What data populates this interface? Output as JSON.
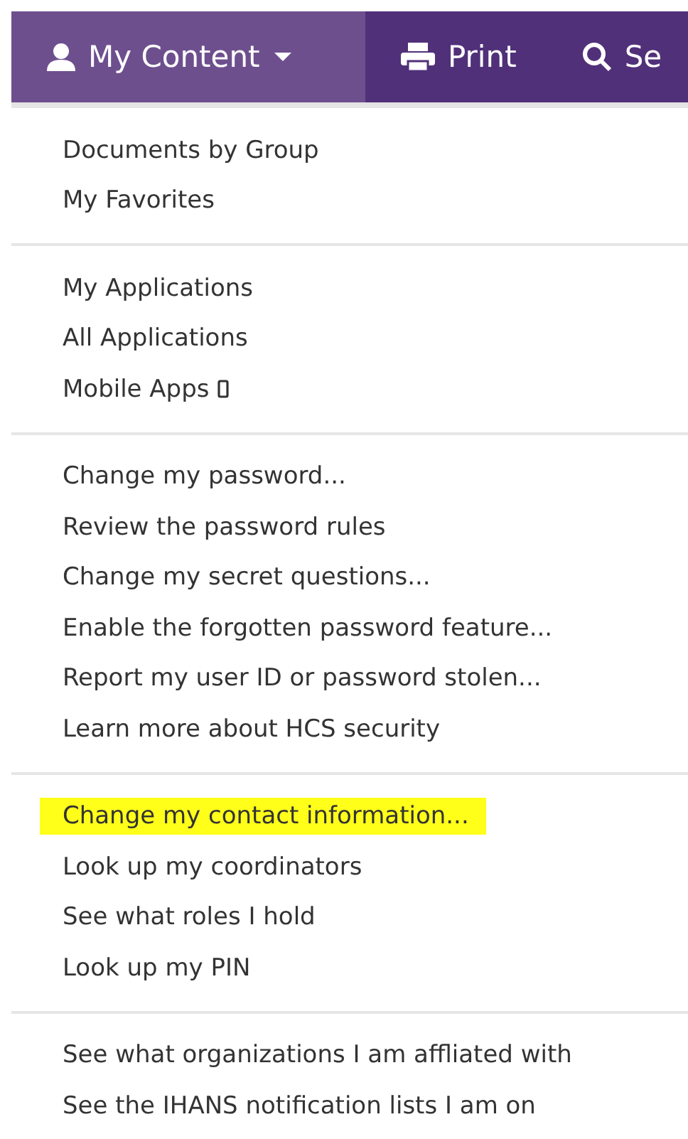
{
  "nav": {
    "tabs": [
      {
        "label": "My Content",
        "kind": "user",
        "caret": true,
        "selected": true
      },
      {
        "label": "Print",
        "kind": "printer",
        "caret": false,
        "selected": false
      },
      {
        "label": "Se",
        "kind": "search",
        "caret": false,
        "selected": false
      }
    ]
  },
  "menu": {
    "groups": [
      {
        "items": [
          {
            "label": "Documents by Group",
            "highlighted": false
          },
          {
            "label": "My Favorites",
            "highlighted": false
          }
        ]
      },
      {
        "items": [
          {
            "label": "My Applications",
            "highlighted": false
          },
          {
            "label": "All Applications",
            "highlighted": false
          },
          {
            "label": "Mobile Apps",
            "kind": "phone",
            "highlighted": false
          }
        ]
      },
      {
        "items": [
          {
            "label": "Change my password...",
            "highlighted": false
          },
          {
            "label": "Review the password rules",
            "highlighted": false
          },
          {
            "label": "Change my secret questions...",
            "highlighted": false
          },
          {
            "label": "Enable the forgotten password feature...",
            "highlighted": false
          },
          {
            "label": "Report my user ID or password stolen...",
            "highlighted": false
          },
          {
            "label": "Learn more about HCS security",
            "highlighted": false
          }
        ]
      },
      {
        "items": [
          {
            "label": "Change my contact information...",
            "highlighted": true
          },
          {
            "label": "Look up my coordinators",
            "highlighted": false
          },
          {
            "label": "See what roles I hold",
            "highlighted": false
          },
          {
            "label": "Look up my PIN",
            "highlighted": false
          }
        ]
      },
      {
        "items": [
          {
            "label": "See what organizations I am affliated with",
            "highlighted": false
          },
          {
            "label": "See the IHANS notification lists I am on",
            "highlighted": false
          }
        ]
      }
    ]
  }
}
